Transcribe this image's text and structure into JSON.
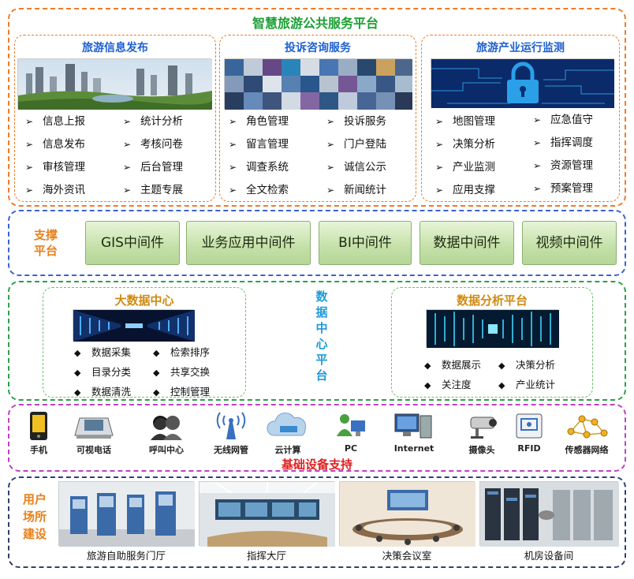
{
  "platform_title": "智慧旅游公共服务平台",
  "panels": [
    {
      "title": "旅游信息发布",
      "col1": [
        "信息上报",
        "信息发布",
        "审核管理",
        "海外资讯"
      ],
      "col2": [
        "统计分析",
        "考核问卷",
        "后台管理",
        "主题专展"
      ]
    },
    {
      "title": "投诉咨询服务",
      "col1": [
        "角色管理",
        "留言管理",
        "调查系统",
        "全文检索"
      ],
      "col2": [
        "投诉服务",
        "门户登陆",
        "诚信公示",
        "新闻统计"
      ]
    },
    {
      "title": "旅游产业运行监测",
      "col1": [
        "地图管理",
        "决策分析",
        "产业监测",
        "应用支撑"
      ],
      "col2": [
        "应急值守",
        "指挥调度",
        "资源管理",
        "预案管理"
      ]
    }
  ],
  "support": {
    "label_line1": "支撑",
    "label_line2": "平台",
    "items": [
      "GIS中间件",
      "业务应用中间件",
      "BI中间件",
      "数据中间件",
      "视频中间件"
    ]
  },
  "data_center": {
    "vertical_label": [
      "数",
      "据",
      "中",
      "心",
      "平",
      "台"
    ],
    "big_data": {
      "title": "大数据中心",
      "col1": [
        "数据采集",
        "目录分类",
        "数据清洗"
      ],
      "col2": [
        "检索排序",
        "共享交换",
        "控制管理"
      ]
    },
    "analysis": {
      "title": "数据分析平台",
      "col1": [
        "数据展示",
        "关注度"
      ],
      "col2": [
        "决策分析",
        "产业统计"
      ]
    }
  },
  "devices": {
    "items": [
      "手机",
      "可视电话",
      "呼叫中心",
      "无线网管",
      "云计算",
      "PC",
      "Internet",
      "摄像头",
      "RFID",
      "传感器网络"
    ],
    "icons": [
      "phone-icon",
      "video-phone-icon",
      "call-center-icon",
      "wireless-icon",
      "cloud-icon",
      "pc-icon",
      "internet-icon",
      "camera-icon",
      "rfid-icon",
      "sensor-network-icon"
    ],
    "title": "基础设备支持"
  },
  "venues": {
    "label": [
      "用户",
      "场所",
      "建设"
    ],
    "items": [
      "旅游自助服务门厅",
      "指挥大厅",
      "决策会议室",
      "机房设备间"
    ]
  },
  "marker_arrow": "➢",
  "marker_diamond": "◆"
}
